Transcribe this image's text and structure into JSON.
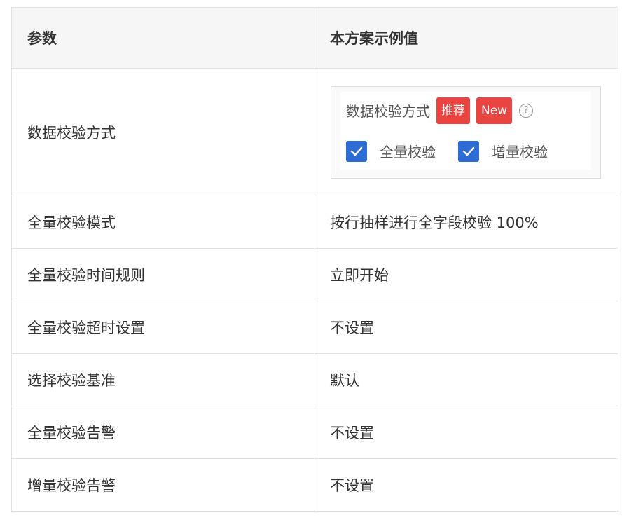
{
  "table": {
    "headers": [
      "参数",
      "本方案示例值"
    ],
    "rows": [
      {
        "param": "数据校验方式",
        "embed": {
          "label": "数据校验方式",
          "badges": [
            "推荐",
            "New"
          ],
          "help_icon": "question-circle-icon",
          "checkboxes": [
            {
              "label": "全量校验",
              "checked": true
            },
            {
              "label": "增量校验",
              "checked": true
            }
          ]
        }
      },
      {
        "param": "全量校验模式",
        "value": "按行抽样进行全字段校验 100%"
      },
      {
        "param": "全量校验时间规则",
        "value": "立即开始"
      },
      {
        "param": "全量校验超时设置",
        "value": "不设置"
      },
      {
        "param": "选择校验基准",
        "value": "默认"
      },
      {
        "param": "全量校验告警",
        "value": "不设置"
      },
      {
        "param": "增量校验告警",
        "value": "不设置"
      }
    ]
  },
  "colors": {
    "badge": "#e9443f",
    "checkbox": "#2d6cd5",
    "header_bg": "#f6f6f6",
    "border": "#e2e2e2"
  }
}
